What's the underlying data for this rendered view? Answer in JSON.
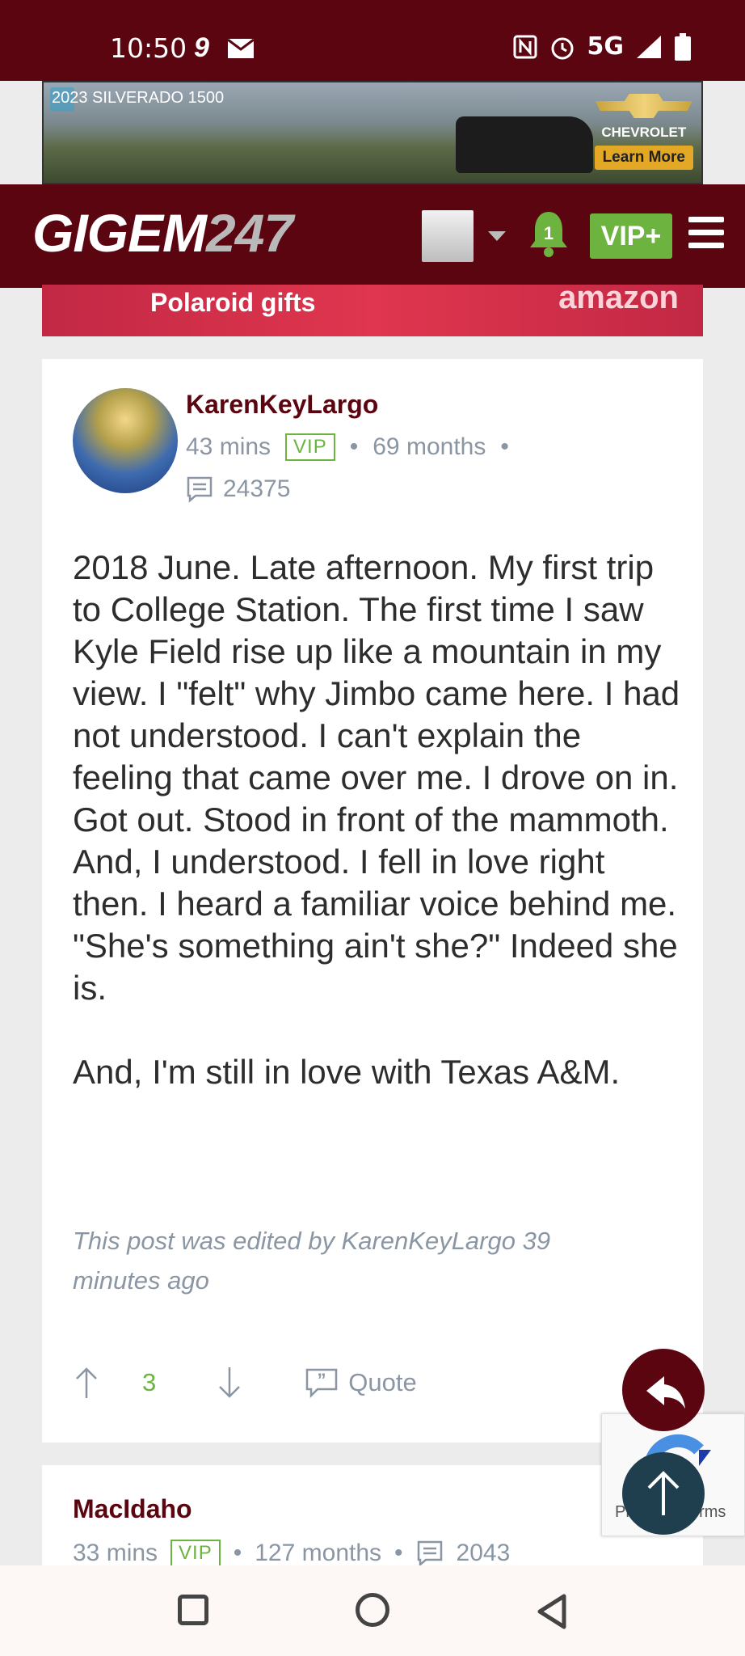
{
  "status_bar": {
    "time": "10:50",
    "network": "5G",
    "icons": [
      "g-icon",
      "mail-icon",
      "nfc-icon",
      "alarm-icon",
      "signal-icon",
      "battery-icon"
    ]
  },
  "top_ad": {
    "label": "2023 SILVERADO 1500",
    "brand": "CHEVROLET",
    "cta": "Learn More"
  },
  "navbar": {
    "logo_text": "GIGEM",
    "logo_num": "247",
    "notification_count": "1",
    "vip_label": "VIP+"
  },
  "second_ad": {
    "text": "Polaroid gifts",
    "brand": "amazon"
  },
  "post": {
    "username": "KarenKeyLargo",
    "time_ago": "43 mins",
    "vip_tag": "VIP",
    "member_duration": "69 months",
    "post_count": "24375",
    "body": "2018 June. Late afternoon. My first trip to College Station. The first time I saw Kyle Field rise up like a mountain in my view. I \"felt\" why Jimbo came here. I had not understood. I can't explain the feeling that came over me. I drove on in. Got out. Stood in front of the mammoth. And, I understood. I fell in love right then. I heard a familiar voice behind me. \"She's something ain't she?\" Indeed she is.\n\nAnd, I'm still in love with Texas A&M.",
    "edited_note": "This post was edited by KarenKeyLargo 39 minutes ago",
    "upvotes": "3",
    "quote_label": "Quote"
  },
  "recaptcha": {
    "text": "Privacy - Terms"
  },
  "next_post": {
    "username": "MacIdaho",
    "time_ago": "33 mins",
    "vip_tag": "VIP",
    "member_duration": "127 months",
    "post_count": "2043"
  },
  "colors": {
    "maroon": "#5a0510",
    "green": "#6db33f",
    "meta_gray": "#8a96a3"
  }
}
